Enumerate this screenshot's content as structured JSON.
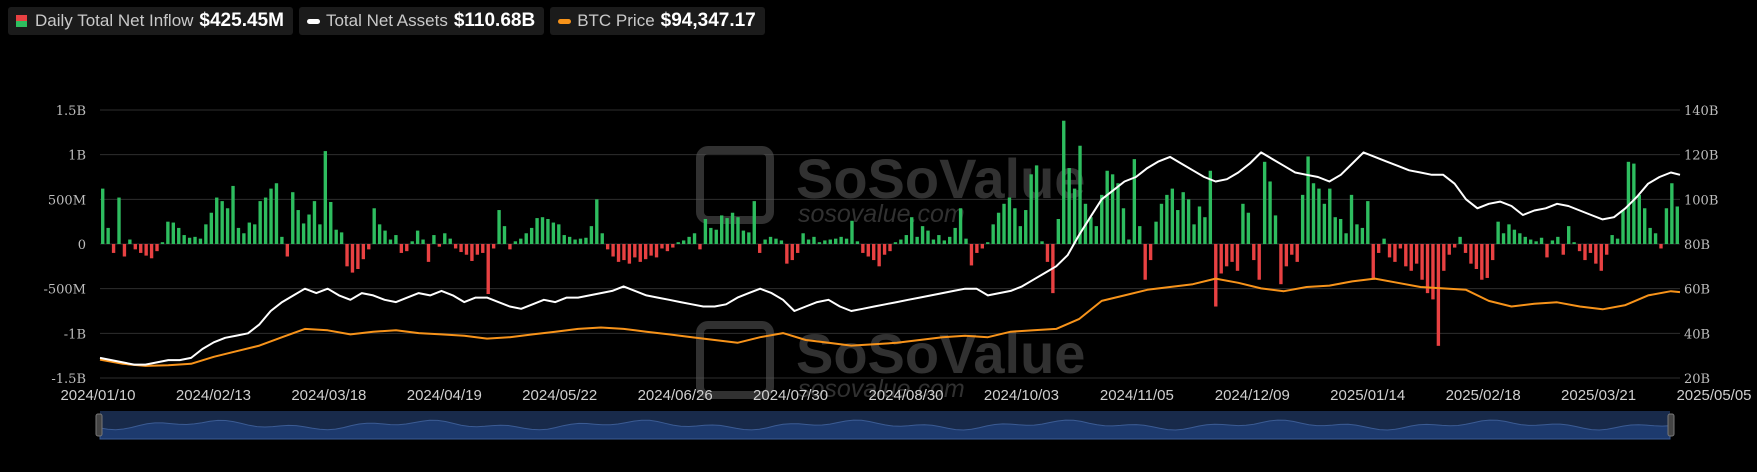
{
  "legend": {
    "inflow": {
      "label": "Daily Total Net Inflow",
      "value": "$425.45M"
    },
    "assets": {
      "label": "Total Net Assets",
      "value": "$110.68B"
    },
    "btc": {
      "label": "BTC Price",
      "value": "$94,347.17"
    }
  },
  "watermark": {
    "brand": "SoSoValue",
    "domain": "sosovalue.com"
  },
  "colors": {
    "positive": "#2ebd5f",
    "negative": "#e84142",
    "assets_line": "#ffffff",
    "btc_line": "#f7931a",
    "grid": "#2e2e2e",
    "zoom_fill": "#1d3a6e"
  },
  "chart_data": {
    "type": "bar+line",
    "x_ticks": [
      "2024/01/10",
      "2024/02/13",
      "2024/03/18",
      "2024/04/19",
      "2024/05/22",
      "2024/06/26",
      "2024/07/30",
      "2024/08/30",
      "2024/10/03",
      "2024/11/05",
      "2024/12/09",
      "2025/01/14",
      "2025/02/18",
      "2025/03/21",
      "2025/05/05"
    ],
    "y_left": {
      "ticks": [
        "1.5B",
        "1B",
        "500M",
        "0",
        "-500M",
        "-1B",
        "-1.5B"
      ],
      "range": [
        -1.5,
        1.5
      ],
      "unit": "B USD"
    },
    "y_right": {
      "ticks": [
        "140B",
        "120B",
        "100B",
        "80B",
        "60B",
        "40B",
        "20B"
      ],
      "range": [
        20,
        140
      ],
      "unit": "B USD"
    },
    "grid": true,
    "series": [
      {
        "name": "Daily Total Net Inflow",
        "type": "bar",
        "unit": "B USD",
        "values": [
          0.62,
          0.18,
          -0.1,
          0.52,
          -0.14,
          0.05,
          -0.06,
          -0.1,
          -0.13,
          -0.16,
          -0.08,
          0.02,
          0.25,
          0.24,
          0.18,
          0.1,
          0.07,
          0.08,
          0.06,
          0.22,
          0.35,
          0.52,
          0.48,
          0.4,
          0.65,
          0.18,
          0.12,
          0.24,
          0.22,
          0.48,
          0.52,
          0.62,
          0.68,
          0.08,
          -0.14,
          0.58,
          0.38,
          0.23,
          0.33,
          0.48,
          0.22,
          1.04,
          0.47,
          0.16,
          0.13,
          -0.25,
          -0.32,
          -0.28,
          -0.17,
          -0.06,
          0.4,
          0.22,
          0.15,
          0.05,
          0.1,
          -0.1,
          -0.08,
          0.03,
          0.15,
          0.05,
          -0.2,
          0.1,
          -0.03,
          0.12,
          0.06,
          -0.05,
          -0.09,
          -0.12,
          -0.19,
          -0.12,
          -0.1,
          -0.56,
          -0.05,
          0.38,
          0.2,
          -0.06,
          0.03,
          0.06,
          0.12,
          0.18,
          0.29,
          0.3,
          0.28,
          0.24,
          0.22,
          0.1,
          0.08,
          0.05,
          0.06,
          0.07,
          0.2,
          0.5,
          0.12,
          -0.06,
          -0.14,
          -0.2,
          -0.18,
          -0.22,
          -0.15,
          -0.2,
          -0.17,
          -0.13,
          -0.15,
          -0.05,
          -0.08,
          -0.04,
          0.02,
          0.04,
          0.08,
          0.12,
          -0.06,
          0.28,
          0.18,
          0.16,
          0.32,
          0.29,
          0.35,
          0.3,
          0.15,
          0.13,
          0.48,
          -0.1,
          0.05,
          0.08,
          0.06,
          0.04,
          -0.22,
          -0.18,
          -0.1,
          0.12,
          0.05,
          0.08,
          0.02,
          0.04,
          0.05,
          0.06,
          0.08,
          0.06,
          0.26,
          0.03,
          -0.1,
          -0.14,
          -0.18,
          -0.25,
          -0.12,
          -0.08,
          0.02,
          0.05,
          0.1,
          0.3,
          0.08,
          0.2,
          0.15,
          0.05,
          0.1,
          0.04,
          0.08,
          0.18,
          0.4,
          0.06,
          -0.24,
          -0.1,
          -0.05,
          0.02,
          0.22,
          0.35,
          0.45,
          0.52,
          0.4,
          0.2,
          0.38,
          0.78,
          0.88,
          0.03,
          -0.2,
          -0.55,
          0.28,
          1.38,
          0.85,
          0.62,
          1.1,
          0.45,
          0.3,
          0.2,
          0.55,
          0.82,
          0.78,
          0.68,
          0.4,
          0.05,
          0.95,
          0.2,
          -0.4,
          -0.18,
          0.25,
          0.45,
          0.55,
          0.62,
          0.38,
          0.58,
          0.5,
          0.22,
          0.42,
          0.3,
          0.82,
          -0.7,
          -0.33,
          -0.25,
          -0.2,
          -0.3,
          0.45,
          0.35,
          -0.18,
          -0.4,
          0.92,
          0.7,
          0.32,
          -0.45,
          -0.25,
          -0.12,
          -0.2,
          0.55,
          0.98,
          0.68,
          0.62,
          0.45,
          0.62,
          0.3,
          0.28,
          0.12,
          0.55,
          0.22,
          0.18,
          0.48,
          -0.4,
          -0.1,
          0.06,
          -0.15,
          -0.2,
          -0.05,
          -0.25,
          -0.3,
          -0.22,
          -0.4,
          -0.55,
          -0.62,
          -1.14,
          -0.3,
          -0.12,
          -0.04,
          0.08,
          -0.1,
          -0.22,
          -0.28,
          -0.4,
          -0.38,
          -0.18,
          0.25,
          0.12,
          0.22,
          0.16,
          0.12,
          0.08,
          0.05,
          0.03,
          0.07,
          -0.15,
          0.04,
          0.08,
          -0.12,
          0.2,
          0.02,
          -0.08,
          -0.18,
          -0.1,
          -0.22,
          -0.3,
          -0.12,
          0.1,
          0.06,
          0.38,
          0.92,
          0.9,
          0.55,
          0.4,
          0.18,
          0.12,
          -0.05,
          0.4,
          0.68,
          0.42
        ]
      },
      {
        "name": "Total Net Assets",
        "type": "line",
        "unit": "B USD",
        "points": [
          [
            0,
            29
          ],
          [
            5,
            28
          ],
          [
            10,
            27
          ],
          [
            15,
            26
          ],
          [
            20,
            26
          ],
          [
            25,
            27
          ],
          [
            30,
            28
          ],
          [
            35,
            28
          ],
          [
            40,
            29
          ],
          [
            45,
            33
          ],
          [
            50,
            36
          ],
          [
            55,
            38
          ],
          [
            60,
            39
          ],
          [
            65,
            40
          ],
          [
            70,
            44
          ],
          [
            75,
            50
          ],
          [
            80,
            54
          ],
          [
            85,
            57
          ],
          [
            90,
            60
          ],
          [
            95,
            58
          ],
          [
            100,
            60
          ],
          [
            105,
            57
          ],
          [
            110,
            55
          ],
          [
            115,
            58
          ],
          [
            120,
            57
          ],
          [
            125,
            55
          ],
          [
            130,
            54
          ],
          [
            135,
            56
          ],
          [
            140,
            58
          ],
          [
            145,
            57
          ],
          [
            150,
            59
          ],
          [
            155,
            57
          ],
          [
            160,
            54
          ],
          [
            165,
            56
          ],
          [
            170,
            56
          ],
          [
            175,
            54
          ],
          [
            180,
            52
          ],
          [
            185,
            51
          ],
          [
            190,
            53
          ],
          [
            195,
            55
          ],
          [
            200,
            54
          ],
          [
            205,
            56
          ],
          [
            210,
            56
          ],
          [
            215,
            57
          ],
          [
            220,
            58
          ],
          [
            225,
            59
          ],
          [
            230,
            61
          ],
          [
            235,
            59
          ],
          [
            240,
            57
          ],
          [
            245,
            56
          ],
          [
            250,
            55
          ],
          [
            255,
            54
          ],
          [
            260,
            53
          ],
          [
            265,
            52
          ],
          [
            270,
            52
          ],
          [
            275,
            53
          ],
          [
            280,
            56
          ],
          [
            285,
            58
          ],
          [
            290,
            60
          ],
          [
            295,
            58
          ],
          [
            300,
            55
          ],
          [
            305,
            50
          ],
          [
            310,
            52
          ],
          [
            315,
            54
          ],
          [
            320,
            55
          ],
          [
            325,
            52
          ],
          [
            330,
            50
          ],
          [
            335,
            51
          ],
          [
            340,
            52
          ],
          [
            345,
            53
          ],
          [
            350,
            54
          ],
          [
            355,
            55
          ],
          [
            360,
            56
          ],
          [
            365,
            57
          ],
          [
            370,
            58
          ],
          [
            375,
            59
          ],
          [
            380,
            60
          ],
          [
            385,
            60
          ],
          [
            390,
            57
          ],
          [
            395,
            58
          ],
          [
            400,
            59
          ],
          [
            405,
            61
          ],
          [
            410,
            64
          ],
          [
            415,
            67
          ],
          [
            420,
            70
          ],
          [
            425,
            75
          ],
          [
            430,
            84
          ],
          [
            435,
            92
          ],
          [
            440,
            100
          ],
          [
            445,
            104
          ],
          [
            450,
            108
          ],
          [
            455,
            110
          ],
          [
            460,
            114
          ],
          [
            465,
            117
          ],
          [
            470,
            119
          ],
          [
            475,
            116
          ],
          [
            480,
            113
          ],
          [
            485,
            110
          ],
          [
            490,
            108
          ],
          [
            495,
            109
          ],
          [
            500,
            112
          ],
          [
            505,
            116
          ],
          [
            510,
            121
          ],
          [
            515,
            118
          ],
          [
            520,
            115
          ],
          [
            525,
            112
          ],
          [
            530,
            111
          ],
          [
            535,
            110
          ],
          [
            540,
            108
          ],
          [
            545,
            111
          ],
          [
            550,
            116
          ],
          [
            555,
            121
          ],
          [
            560,
            119
          ],
          [
            565,
            117
          ],
          [
            570,
            115
          ],
          [
            575,
            113
          ],
          [
            580,
            112
          ],
          [
            585,
            111
          ],
          [
            590,
            111
          ],
          [
            595,
            107
          ],
          [
            600,
            100
          ],
          [
            605,
            96
          ],
          [
            610,
            98
          ],
          [
            615,
            99
          ],
          [
            620,
            97
          ],
          [
            625,
            93
          ],
          [
            630,
            95
          ],
          [
            635,
            96
          ],
          [
            640,
            98
          ],
          [
            645,
            97
          ],
          [
            650,
            95
          ],
          [
            655,
            93
          ],
          [
            660,
            91
          ],
          [
            665,
            92
          ],
          [
            670,
            96
          ],
          [
            675,
            101
          ],
          [
            680,
            107
          ],
          [
            685,
            110
          ],
          [
            690,
            112
          ],
          [
            694,
            111
          ]
        ]
      },
      {
        "name": "BTC Price",
        "type": "line",
        "unit": "USD",
        "points": [
          [
            0,
            46000
          ],
          [
            10,
            43000
          ],
          [
            20,
            41500
          ],
          [
            30,
            42000
          ],
          [
            40,
            43000
          ],
          [
            50,
            48000
          ],
          [
            60,
            52000
          ],
          [
            70,
            56000
          ],
          [
            80,
            62000
          ],
          [
            90,
            68000
          ],
          [
            100,
            67000
          ],
          [
            110,
            64000
          ],
          [
            120,
            66000
          ],
          [
            130,
            67000
          ],
          [
            140,
            65000
          ],
          [
            150,
            64000
          ],
          [
            160,
            63000
          ],
          [
            170,
            61000
          ],
          [
            180,
            62000
          ],
          [
            190,
            64000
          ],
          [
            200,
            66000
          ],
          [
            210,
            68000
          ],
          [
            220,
            69000
          ],
          [
            230,
            68000
          ],
          [
            240,
            66000
          ],
          [
            250,
            64000
          ],
          [
            260,
            62000
          ],
          [
            270,
            60000
          ],
          [
            280,
            58000
          ],
          [
            290,
            62000
          ],
          [
            300,
            65000
          ],
          [
            310,
            60000
          ],
          [
            320,
            58000
          ],
          [
            330,
            56000
          ],
          [
            340,
            57000
          ],
          [
            350,
            58000
          ],
          [
            360,
            60000
          ],
          [
            370,
            62000
          ],
          [
            380,
            63000
          ],
          [
            390,
            62000
          ],
          [
            400,
            66000
          ],
          [
            410,
            67000
          ],
          [
            420,
            68000
          ],
          [
            430,
            75000
          ],
          [
            440,
            88000
          ],
          [
            450,
            92000
          ],
          [
            460,
            96000
          ],
          [
            470,
            98000
          ],
          [
            480,
            100000
          ],
          [
            490,
            104000
          ],
          [
            500,
            101000
          ],
          [
            510,
            97000
          ],
          [
            520,
            95000
          ],
          [
            530,
            98000
          ],
          [
            540,
            99000
          ],
          [
            550,
            102000
          ],
          [
            560,
            104000
          ],
          [
            570,
            101000
          ],
          [
            580,
            98000
          ],
          [
            590,
            97000
          ],
          [
            600,
            96000
          ],
          [
            610,
            88000
          ],
          [
            620,
            84000
          ],
          [
            630,
            86000
          ],
          [
            640,
            87000
          ],
          [
            650,
            84000
          ],
          [
            660,
            82000
          ],
          [
            670,
            85000
          ],
          [
            680,
            92000
          ],
          [
            690,
            95000
          ],
          [
            694,
            94347
          ]
        ]
      }
    ]
  }
}
